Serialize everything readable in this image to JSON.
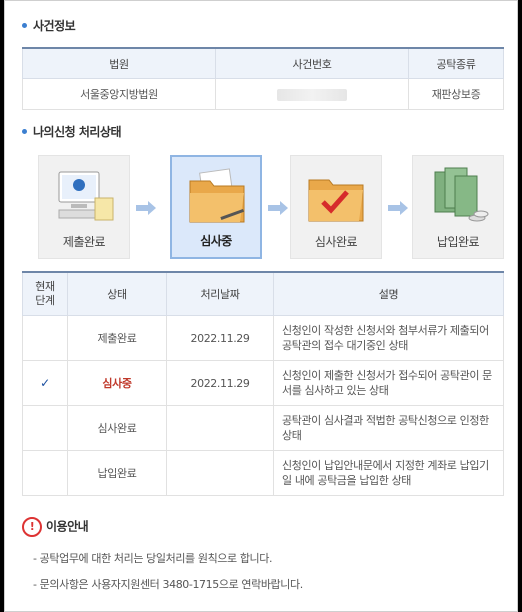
{
  "case_info": {
    "title": "사건정보",
    "headers": [
      "법원",
      "사건번호",
      "공탁종류"
    ],
    "row": [
      "서울중앙지방법원",
      "",
      "재판상보증"
    ]
  },
  "status": {
    "title": "나의신청 처리상태",
    "steps": [
      {
        "label": "제출완료",
        "icon": "computer-document-icon"
      },
      {
        "label": "심사중",
        "icon": "open-folder-icon"
      },
      {
        "label": "심사완료",
        "icon": "folder-check-icon"
      },
      {
        "label": "납입완료",
        "icon": "money-stack-icon"
      }
    ],
    "active_step": 1,
    "table_headers": [
      "현재\n단계",
      "상태",
      "처리날짜",
      "설명"
    ],
    "rows": [
      {
        "current": "",
        "state": "제출완료",
        "date": "2022.11.29",
        "desc": "신청인이 작성한 신청서와 첨부서류가 제출되어 공탁관의 접수 대기중인 상태"
      },
      {
        "current": "✓",
        "state": "심사중",
        "date": "2022.11.29",
        "desc": "신청인이 제출한 신청서가 접수되어 공탁관이 문서를 심사하고 있는 상태"
      },
      {
        "current": "",
        "state": "심사완료",
        "date": "",
        "desc": "공탁관이 심사결과 적법한 공탁신청으로 인정한 상태"
      },
      {
        "current": "",
        "state": "납입완료",
        "date": "",
        "desc": "신청인이 납입안내문에서 지정한 계좌로 납입기일 내에 공탁금을 납입한 상태"
      }
    ]
  },
  "guide": {
    "title": "이용안내",
    "notes": [
      "- 공탁업무에 대한 처리는 당일처리를 원칙으로 합니다.",
      "- 문의사항은 사용자지원센터 3480-1715으로 연락바랍니다."
    ]
  },
  "colors": {
    "accent": "#3b7fd0",
    "current_state": "#c0392b",
    "header_bg": "#eef3fa"
  }
}
